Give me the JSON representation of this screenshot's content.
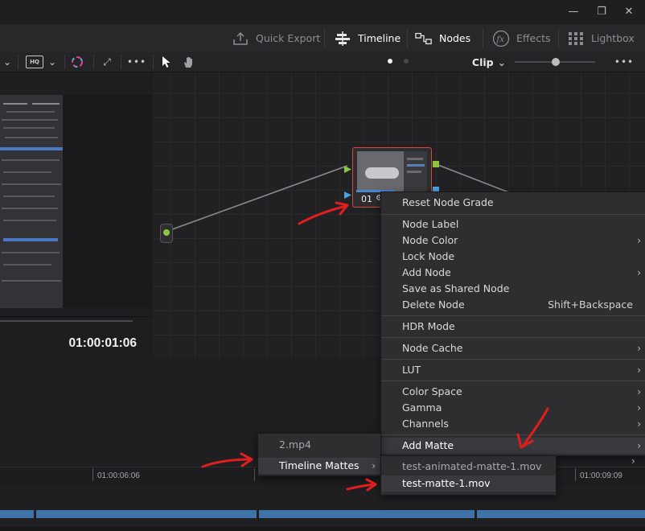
{
  "pagebar": {
    "quick_export": "Quick Export",
    "timeline": "Timeline",
    "nodes": "Nodes",
    "effects": "Effects",
    "lightbox": "Lightbox"
  },
  "toolrow": {
    "more": "•••",
    "mode_label": "Clip",
    "viewer_icon_badge": "HQ"
  },
  "viewer": {
    "timecode": "01:00:01:06"
  },
  "node": {
    "label": "01"
  },
  "context_menu": {
    "items": [
      {
        "label": "Reset Node Grade"
      },
      {
        "label": "Node Label"
      },
      {
        "label": "Node Color",
        "submenu": true
      },
      {
        "label": "Lock Node"
      },
      {
        "label": "Add Node",
        "submenu": true
      },
      {
        "label": "Save as Shared Node"
      },
      {
        "label": "Delete Node",
        "shortcut": "Shift+Backspace"
      },
      {
        "label": "HDR Mode"
      },
      {
        "label": "Node Cache",
        "submenu": true
      },
      {
        "label": "LUT",
        "submenu": true
      },
      {
        "label": "Color Space",
        "submenu": true
      },
      {
        "label": "Gamma",
        "submenu": true
      },
      {
        "label": "Channels",
        "submenu": true
      },
      {
        "label": "Add Matte",
        "submenu": true
      }
    ]
  },
  "matte_source_menu": {
    "items": [
      {
        "label": "2.mp4"
      },
      {
        "label": "Timeline Mattes",
        "submenu": true
      }
    ]
  },
  "timeline_mattes_menu": {
    "items": [
      {
        "label": "test-animated-matte-1.mov"
      },
      {
        "label": "test-matte-1.mov"
      }
    ]
  },
  "timeline": {
    "timecodes": [
      "01:00:06:06",
      "01:00:09:09"
    ]
  },
  "colors": {
    "node_border": "#d24a3e",
    "port_green": "#8cc63f",
    "port_blue": "#4aa3df",
    "clip_blue": "#3f73a8",
    "annotation_red": "#e01e1e"
  }
}
